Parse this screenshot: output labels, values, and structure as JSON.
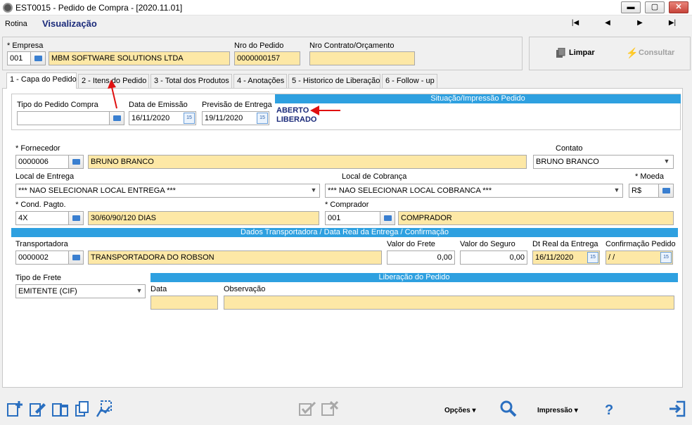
{
  "window": {
    "title": "EST0015 - Pedido de Compra - [2020.11.01]",
    "min_label": "▬",
    "max_label": "▢",
    "close_label": "✕"
  },
  "menu": {
    "rotina": "Rotina",
    "mode": "Visualização"
  },
  "nav": {
    "first": "|◀",
    "prev": "◀",
    "next": "▶",
    "last": "▶|"
  },
  "header": {
    "empresa_label": "Empresa",
    "empresa_code": "001",
    "empresa_name": "MBM SOFTWARE SOLUTIONS LTDA",
    "nro_pedido_label": "Nro do Pedido",
    "nro_pedido": "0000000157",
    "nro_contrato_label": "Nro Contrato/Orçamento",
    "nro_contrato": "",
    "limpar_label": "Limpar",
    "consultar_label": "Consultar"
  },
  "tabs": [
    {
      "label": "1 - Capa do Pedido"
    },
    {
      "label": "2 - Itens do Pedido"
    },
    {
      "label": "3 - Total dos Produtos"
    },
    {
      "label": "4 - Anotações"
    },
    {
      "label": "5 - Historico de Liberação"
    },
    {
      "label": "6 - Follow - up"
    }
  ],
  "capa": {
    "tipo_pedido_label": "Tipo do Pedido Compra",
    "tipo_pedido": "",
    "data_emissao_label": "Data de Emissão",
    "data_emissao": "16/11/2020",
    "previsao_label": "Previsão de Entrega",
    "previsao": "19/11/2020",
    "situacao_title": "Situação/Impressão Pedido",
    "situacao_1": "ABERTO",
    "situacao_2": "LIBERADO",
    "fornecedor_label": "Fornecedor",
    "fornecedor_code": "0000006",
    "fornecedor_name": "BRUNO BRANCO",
    "contato_label": "Contato",
    "contato": "BRUNO BRANCO",
    "local_entrega_label": "Local de Entrega",
    "local_entrega": "*** NAO SELECIONAR LOCAL ENTREGA ***",
    "local_cobranca_label": "Local de Cobrança",
    "local_cobranca": "*** NAO SELECIONAR LOCAL COBRANCA ***",
    "moeda_label": "Moeda",
    "moeda": "R$",
    "cond_pagto_label": "Cond. Pagto.",
    "cond_pagto_code": "4X",
    "cond_pagto_desc": "30/60/90/120 DIAS",
    "comprador_label": "Comprador",
    "comprador_code": "001",
    "comprador_name": "COMPRADOR",
    "transp_section": "Dados Transportadora / Data Real da Entrega / Confirmação",
    "transportadora_label": "Transportadora",
    "transportadora_code": "0000002",
    "transportadora_name": "TRANSPORTADORA DO ROBSON",
    "valor_frete_label": "Valor do Frete",
    "valor_frete": "0,00",
    "valor_seguro_label": "Valor do Seguro",
    "valor_seguro": "0,00",
    "dt_real_label": "Dt Real da Entrega",
    "dt_real": "16/11/2020",
    "confirmacao_label": "Confirmação Pedido",
    "confirmacao": " /  /",
    "tipo_frete_label": "Tipo de Frete",
    "tipo_frete": "EMITENTE (CIF)",
    "liberacao_title": "Liberação do Pedido",
    "data_label": "Data",
    "data": "",
    "observacao_label": "Observação",
    "observacao": ""
  },
  "toolbar": {
    "opcoes_label": "Opções ▾",
    "impressao_label": "Impressão ▾",
    "help_label": "?"
  },
  "colors": {
    "section": "#2ea0e0",
    "required_field": "#fde8a6",
    "status_text": "#1a2a7a",
    "arrow": "#e01010"
  }
}
